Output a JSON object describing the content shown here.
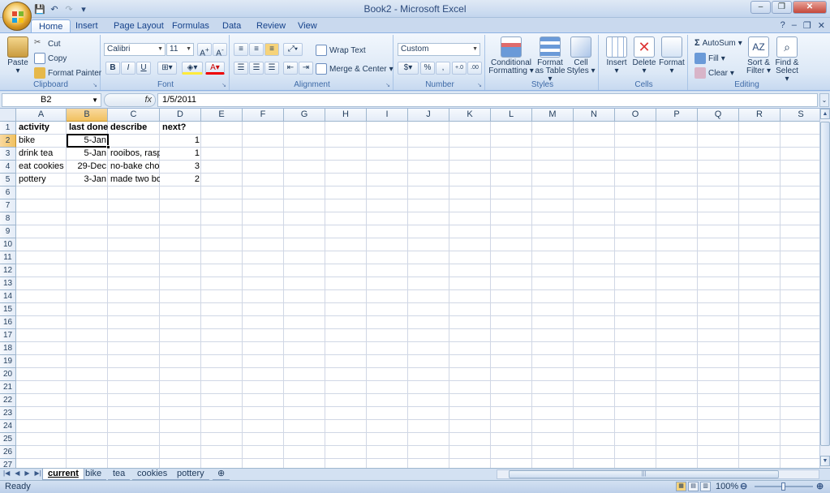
{
  "window": {
    "title": "Book2 - Microsoft Excel"
  },
  "qat": {
    "save": "💾",
    "undo": "↶",
    "redo": "↷"
  },
  "ribbon_tabs": [
    "Home",
    "Insert",
    "Page Layout",
    "Formulas",
    "Data",
    "Review",
    "View"
  ],
  "clipboard": {
    "paste": "Paste",
    "cut": "Cut",
    "copy": "Copy",
    "format_painter": "Format Painter",
    "label": "Clipboard"
  },
  "font": {
    "name": "Calibri",
    "size": "11",
    "label": "Font",
    "bold": "B",
    "italic": "I",
    "underline": "U"
  },
  "alignment": {
    "wrap": "Wrap Text",
    "merge": "Merge & Center",
    "label": "Alignment"
  },
  "number": {
    "format": "Custom",
    "currency": "$",
    "percent": "%",
    "comma": ",",
    "inc_decimal": "+.0",
    "dec_decimal": ".00",
    "label": "Number"
  },
  "styles": {
    "cond1": "Conditional",
    "cond2": "Formatting",
    "table1": "Format",
    "table2": "as Table",
    "cell1": "Cell",
    "cell2": "Styles",
    "label": "Styles"
  },
  "cells": {
    "insert": "Insert",
    "delete": "Delete",
    "format": "Format",
    "label": "Cells"
  },
  "editing": {
    "autosum": "AutoSum",
    "fill": "Fill",
    "clear": "Clear",
    "sort1": "Sort &",
    "sort2": "Filter",
    "find1": "Find &",
    "find2": "Select",
    "label": "Editing"
  },
  "formula_bar": {
    "name_box": "B2",
    "fx": "fx",
    "value": "1/5/2011"
  },
  "columns": [
    "A",
    "B",
    "C",
    "D",
    "E",
    "F",
    "G",
    "H",
    "I",
    "J",
    "K",
    "L",
    "M",
    "N",
    "O",
    "P",
    "Q",
    "R",
    "S"
  ],
  "rows": [
    "1",
    "2",
    "3",
    "4",
    "5",
    "6",
    "7",
    "8",
    "9",
    "10",
    "11",
    "12",
    "13",
    "14",
    "15",
    "16",
    "17",
    "18",
    "19",
    "20",
    "21",
    "22",
    "23",
    "24",
    "25",
    "26",
    "27"
  ],
  "cells_data": {
    "r1": {
      "a": "activity",
      "b": "last done",
      "c": "describe",
      "d": "next?"
    },
    "r2": {
      "a": "bike",
      "b": "5-Jan",
      "c": "",
      "d": "1"
    },
    "r3": {
      "a": "drink tea",
      "b": "5-Jan",
      "c": "rooibos, rasp",
      "d": "1"
    },
    "r4": {
      "a": "eat cookies",
      "b": "29-Dec",
      "c": "no-bake choc",
      "d": "3"
    },
    "r5": {
      "a": "pottery",
      "b": "3-Jan",
      "c": "made two bo",
      "d": "2"
    }
  },
  "sheet_tabs": [
    "current",
    "bike",
    "tea",
    "cookies",
    "pottery"
  ],
  "status": {
    "ready": "Ready",
    "zoom": "100%"
  }
}
